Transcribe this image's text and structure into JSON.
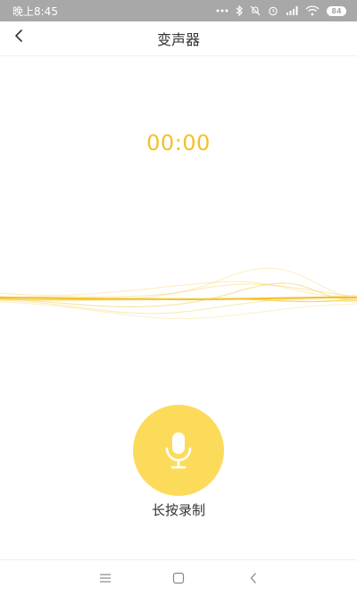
{
  "status_bar": {
    "time": "晚上8:45",
    "battery": "84",
    "icons": [
      "dots-icon",
      "bluetooth-icon",
      "mute-bell-icon",
      "alarm-icon",
      "cellular-icon",
      "wifi-icon",
      "battery-icon"
    ]
  },
  "header": {
    "title": "变声器",
    "back_icon": "chevron-left-icon"
  },
  "recorder": {
    "timer": "00:00",
    "hint": "长按录制",
    "mic_icon": "microphone-icon",
    "accent_color": "#f2c12b",
    "button_color": "#fddb5a"
  },
  "system_nav": {
    "icons": [
      "menu-icon",
      "home-icon",
      "back-icon"
    ]
  }
}
